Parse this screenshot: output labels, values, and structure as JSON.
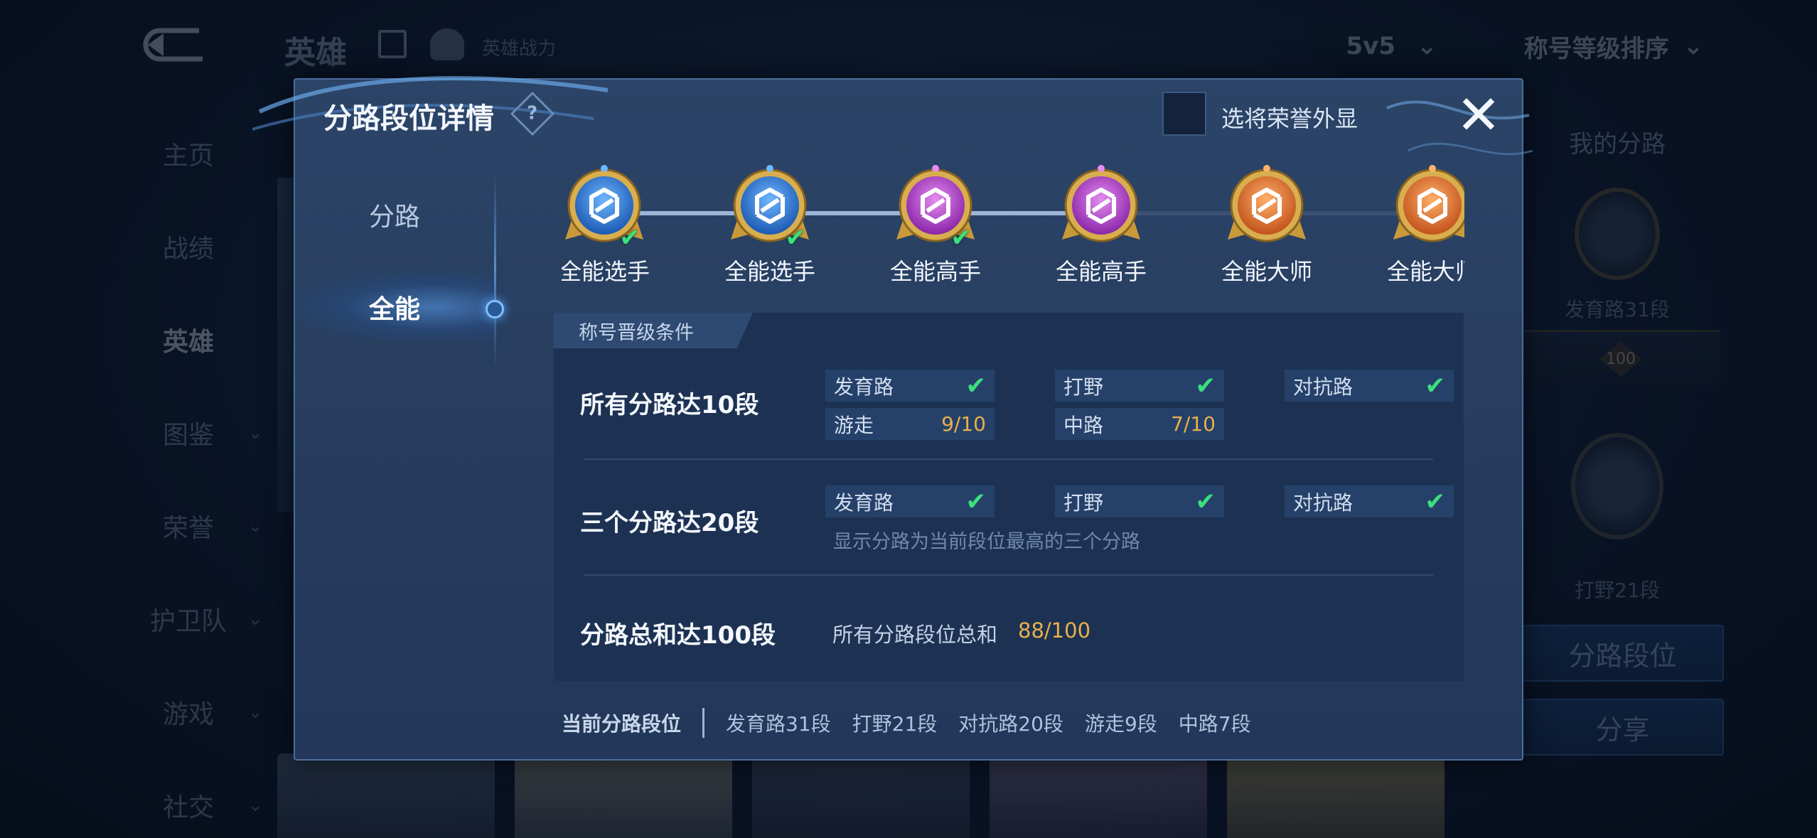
{
  "background": {
    "top_title": "英雄",
    "hero_power": "英雄战力",
    "mode_select": "5v5",
    "sort_select": "称号等级排序",
    "nav": [
      {
        "label": "主页"
      },
      {
        "label": "战绩"
      },
      {
        "label": "英雄"
      },
      {
        "label": "图鉴"
      },
      {
        "label": "荣誉"
      },
      {
        "label": "护卫队"
      },
      {
        "label": "游戏"
      },
      {
        "label": "社交"
      }
    ],
    "right_panel": {
      "title": "我的分路",
      "badge1_label": "发育路31段",
      "badge_number": "100",
      "badge2_label": "打野21段",
      "btn_lane_rank": "分路段位",
      "btn_share": "分享"
    }
  },
  "modal": {
    "title": "分路段位详情",
    "help": "?",
    "honor_display_label": "选将荣誉外显",
    "close": "✕",
    "tabs": [
      {
        "label": "分路"
      },
      {
        "label": "全能"
      }
    ],
    "medals": [
      {
        "name": "全能选手",
        "color": "blue",
        "done": true
      },
      {
        "name": "全能选手",
        "color": "blue",
        "done": true
      },
      {
        "name": "全能高手",
        "color": "purple",
        "done": true
      },
      {
        "name": "全能高手",
        "color": "purple",
        "done": false
      },
      {
        "name": "全能大师",
        "color": "orange",
        "done": false
      },
      {
        "name": "全能大师",
        "color": "orange",
        "done": false
      }
    ],
    "conditions_header": "称号晋级条件",
    "condition1": {
      "label": "所有分路达10段",
      "chips": [
        {
          "name": "发育路",
          "status": "✔"
        },
        {
          "name": "打野",
          "status": "✔"
        },
        {
          "name": "对抗路",
          "status": "✔"
        },
        {
          "name": "游走",
          "progress": "9/10"
        },
        {
          "name": "中路",
          "progress": "7/10"
        }
      ]
    },
    "condition2": {
      "label": "三个分路达20段",
      "chips": [
        {
          "name": "发育路",
          "status": "✔"
        },
        {
          "name": "打野",
          "status": "✔"
        },
        {
          "name": "对抗路",
          "status": "✔"
        }
      ],
      "note": "显示分路为当前段位最高的三个分路"
    },
    "condition3": {
      "label": "分路总和达100段",
      "sum_label": "所有分路段位总和",
      "sum_value": "88/100"
    },
    "footer": {
      "current_label": "当前分路段位",
      "items": [
        "发育路31段",
        "打野21段",
        "对抗路20段",
        "游走9段",
        "中路7段"
      ]
    }
  }
}
